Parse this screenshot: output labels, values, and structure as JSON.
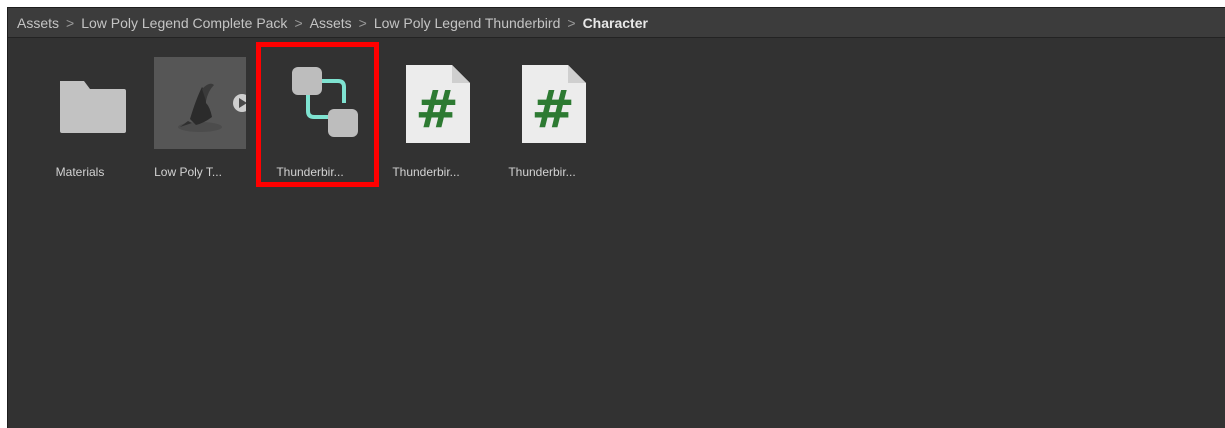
{
  "breadcrumb": {
    "items": [
      "Assets",
      "Low Poly Legend Complete Pack",
      "Assets",
      "Low Poly Legend Thunderbird",
      "Character"
    ],
    "separator": ">"
  },
  "assets": [
    {
      "label": "Materials",
      "icon": "folder-icon"
    },
    {
      "label": "Low Poly T...",
      "icon": "model-preview-icon"
    },
    {
      "label": "Thunderbir...",
      "icon": "animator-controller-icon",
      "selected": true
    },
    {
      "label": "Thunderbir...",
      "icon": "csharp-script-icon"
    },
    {
      "label": "Thunderbir...",
      "icon": "csharp-script-icon"
    }
  ],
  "colors": {
    "panel_bg": "#323232",
    "folder": "#c2c2c2",
    "script_green": "#2d7a32",
    "controller_teal": "#7fe3d1",
    "highlight": "#ff0000"
  }
}
